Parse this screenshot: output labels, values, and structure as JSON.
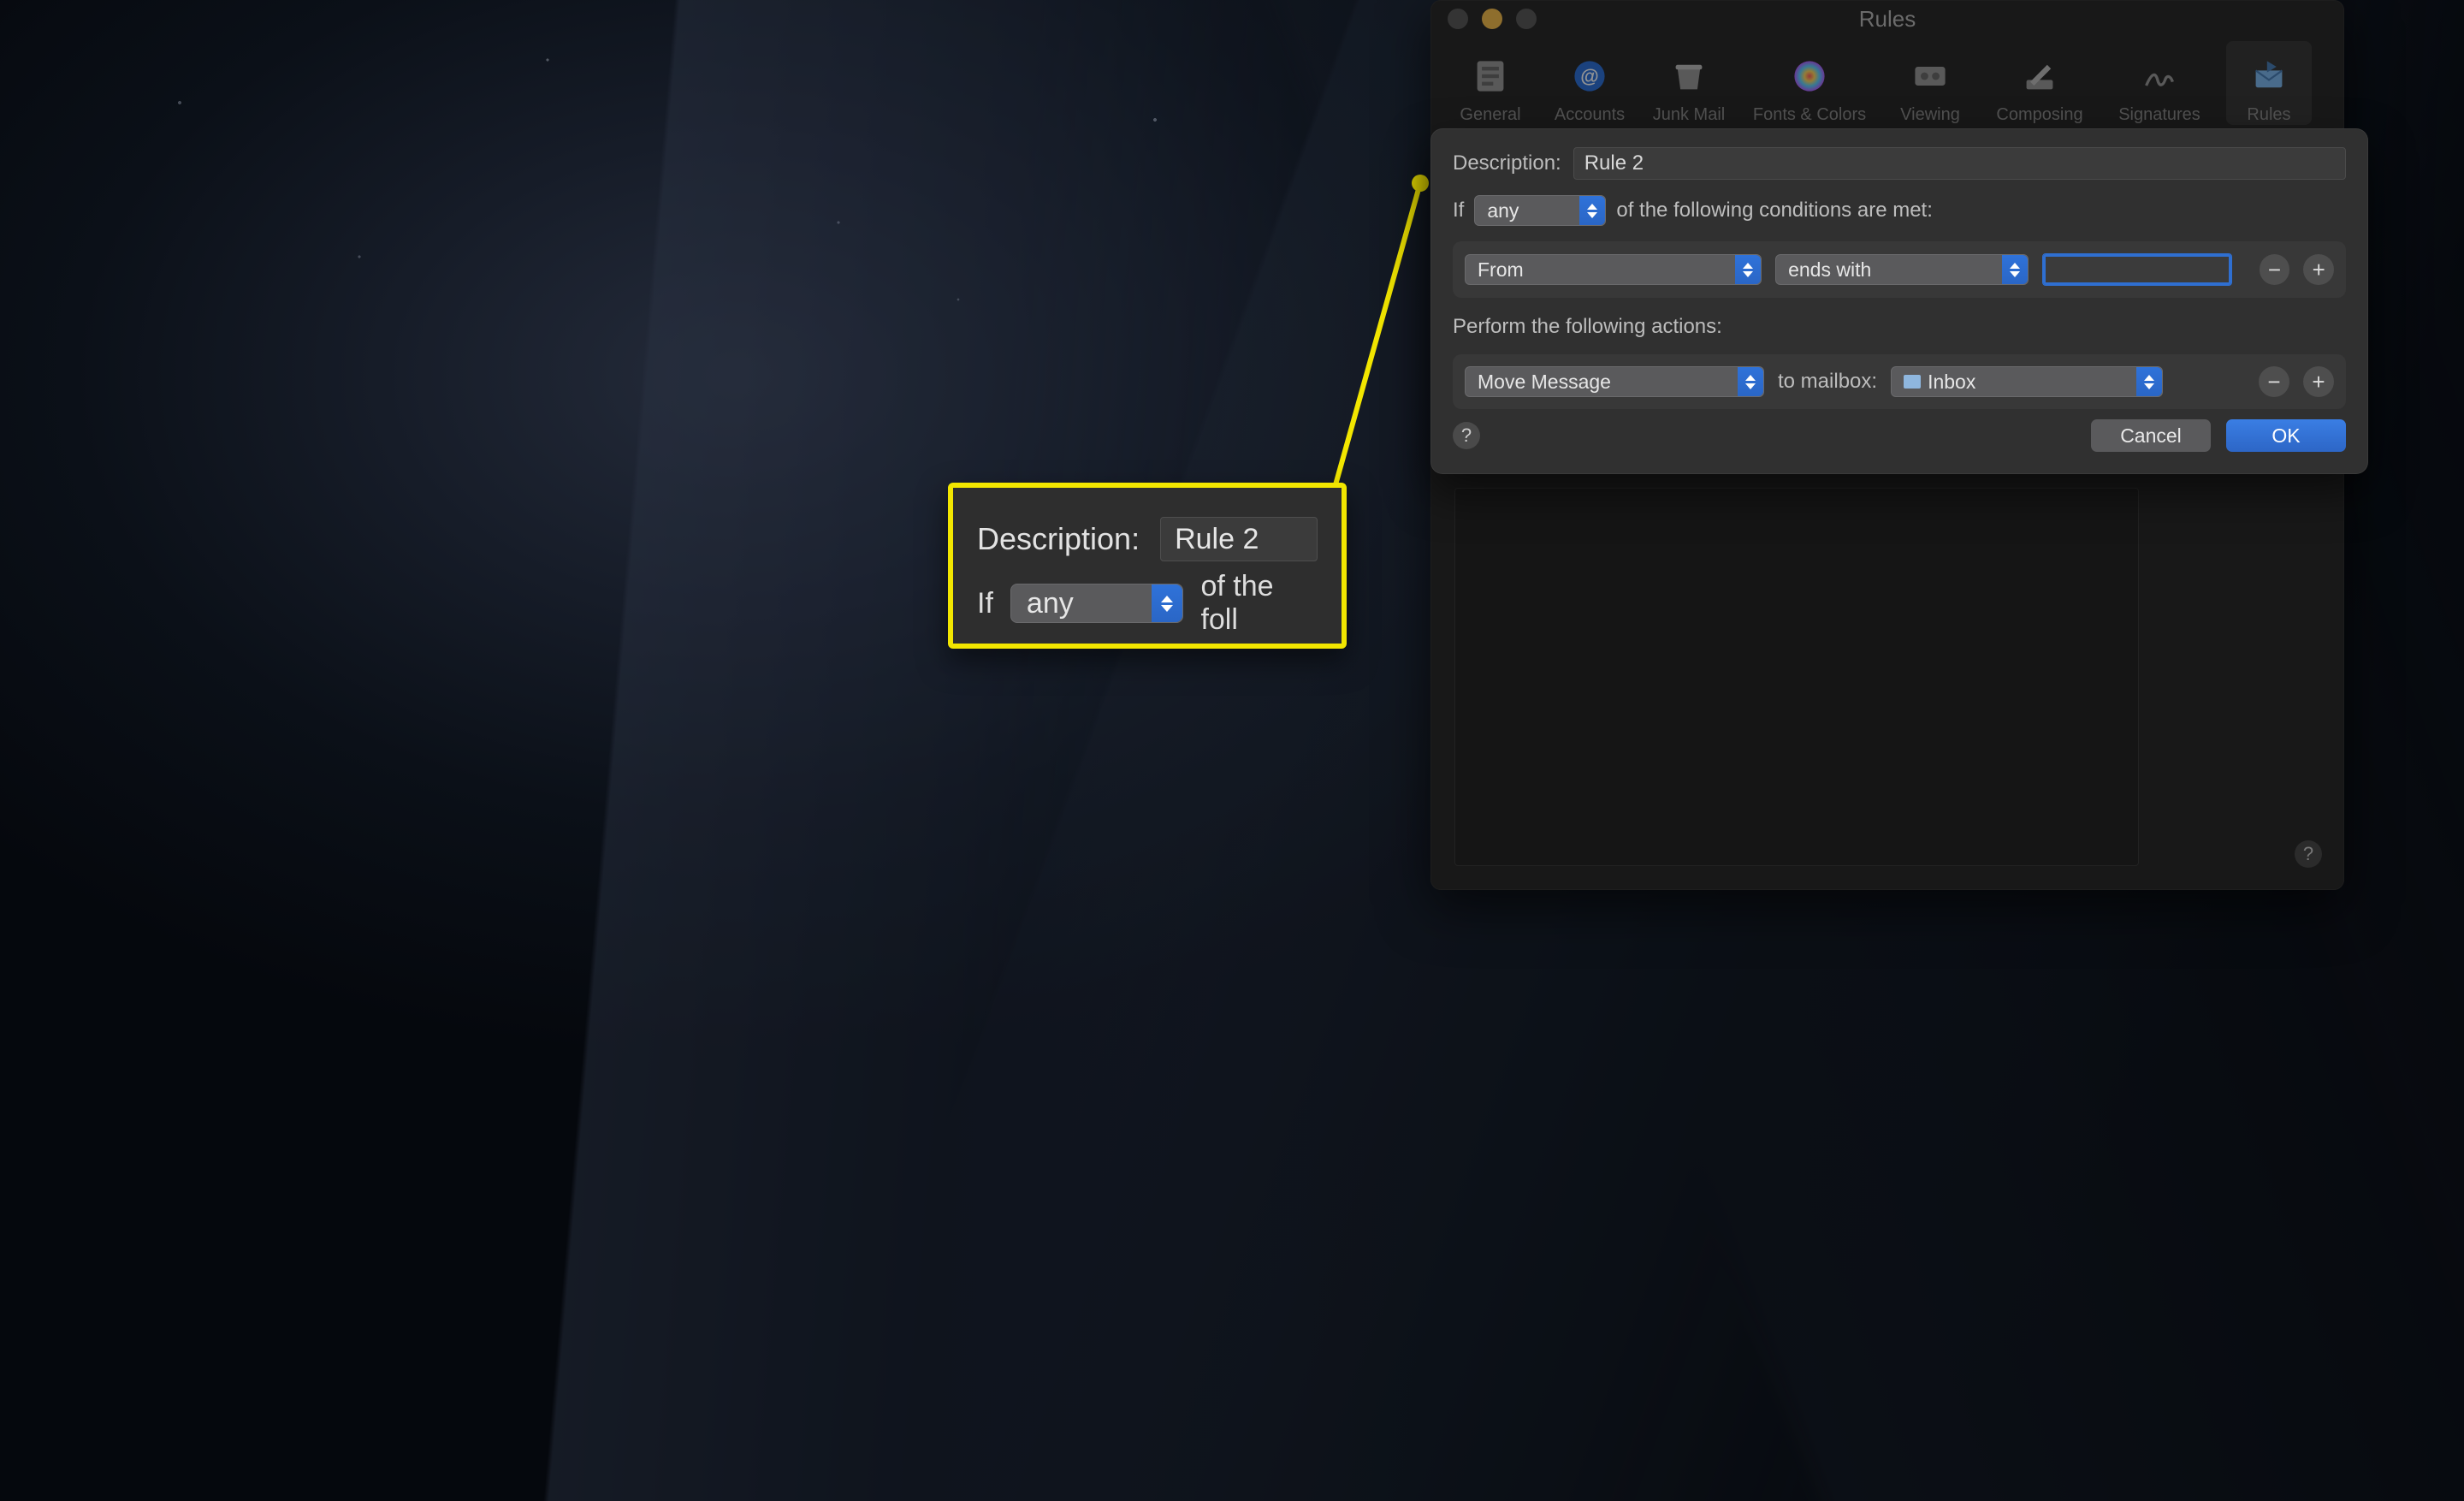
{
  "window": {
    "title": "Rules",
    "tabs": [
      {
        "label": "General"
      },
      {
        "label": "Accounts"
      },
      {
        "label": "Junk Mail"
      },
      {
        "label": "Fonts & Colors"
      },
      {
        "label": "Viewing"
      },
      {
        "label": "Composing"
      },
      {
        "label": "Signatures"
      },
      {
        "label": "Rules"
      }
    ]
  },
  "sheet": {
    "description_label": "Description:",
    "description_value": "Rule 2",
    "if_prefix": "If",
    "if_mode": "any",
    "if_suffix": "of the following conditions are met:",
    "condition": {
      "field": "From",
      "operator": "ends with",
      "value": ""
    },
    "actions_label": "Perform the following actions:",
    "action": {
      "verb": "Move Message",
      "to_label": "to mailbox:",
      "mailbox": "Inbox"
    },
    "cancel": "Cancel",
    "ok": "OK",
    "help": "?"
  },
  "callout": {
    "description_label": "Description:",
    "description_value": "Rule 2",
    "if_prefix": "If",
    "if_mode": "any",
    "if_suffix_partial": "of the foll"
  },
  "colors": {
    "accent": "#2f72d9",
    "highlight": "#f2e600"
  }
}
